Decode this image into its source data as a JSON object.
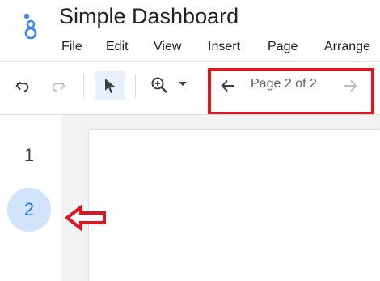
{
  "app": {
    "title": "Simple Dashboard",
    "logo_icon": "looker-studio-logo-icon"
  },
  "menu": {
    "items": [
      "File",
      "Edit",
      "View",
      "Insert",
      "Page",
      "Arrange"
    ]
  },
  "toolbar": {
    "icons": {
      "undo": "undo-icon",
      "redo": "redo-icon",
      "select": "cursor-arrow-icon",
      "zoom": "zoom-in-icon",
      "zoom_dropdown": "caret-down-icon",
      "prev_page": "arrow-left-icon",
      "next_page": "arrow-right-icon"
    },
    "page_indicator": "Page 2 of 2"
  },
  "pages": {
    "items": [
      {
        "label": "1",
        "selected": false
      },
      {
        "label": "2",
        "selected": true
      }
    ]
  },
  "colors": {
    "highlight": "#e0141e",
    "selected_page_bg": "#d2e3fc",
    "selected_page_text": "#1a73e8",
    "select_tool_bg": "#e8f0fe"
  }
}
